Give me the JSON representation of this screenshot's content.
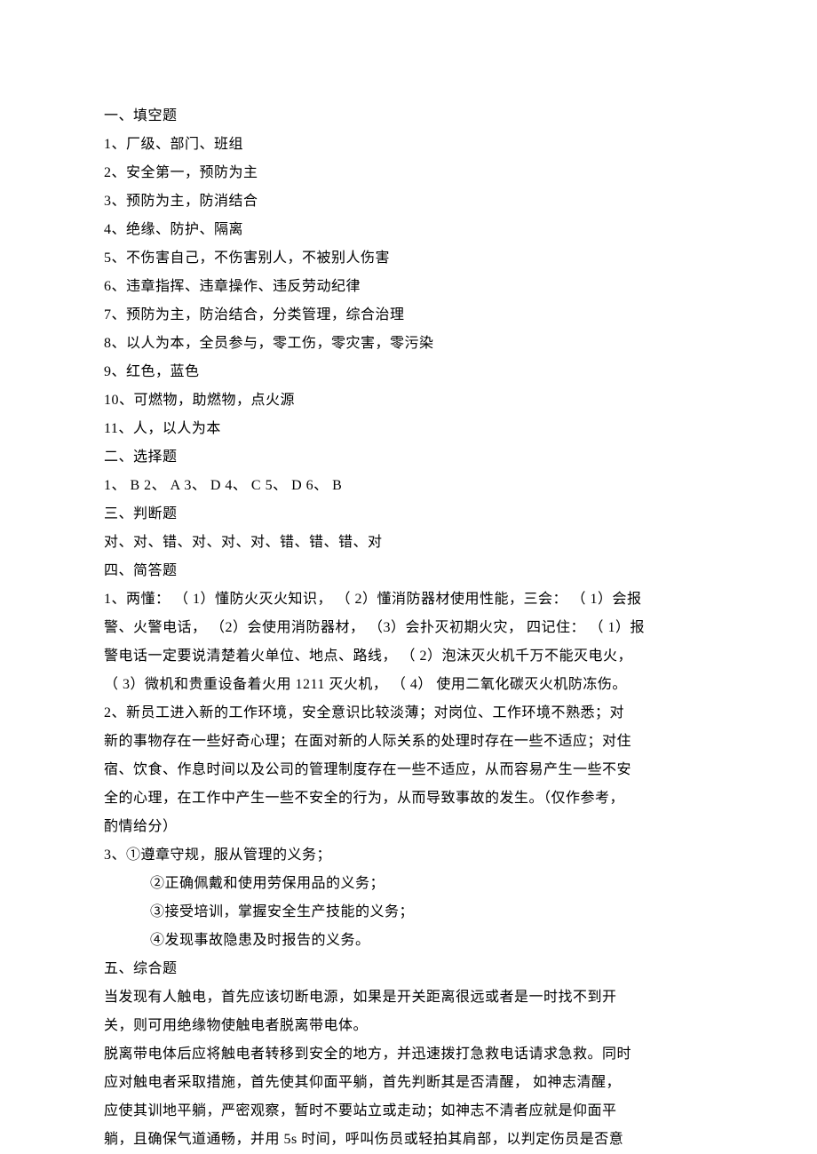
{
  "sections": {
    "s1_title": "一、填空题",
    "s1_items": [
      "1、厂级、部门、班组",
      "2、安全第一，预防为主",
      "3、预防为主，防消结合",
      "4、绝缘、防护、隔离",
      "5、不伤害自己，不伤害别人，不被别人伤害",
      "6、违章指挥、违章操作、违反劳动纪律",
      "7、预防为主，防治结合，分类管理，综合治理",
      "8、以人为本，全员参与，零工伤，零灾害，零污染",
      "9、红色，蓝色",
      "10、可燃物，助燃物，点火源",
      "11、人，以人为本"
    ],
    "s2_title": "二、选择题",
    "s2_content": "1、 B 2、 A 3、 D 4、 C 5、 D 6、 B",
    "s3_title": "三、判断题",
    "s3_content": "对、对、错、对、对、对、错、错、错、对",
    "s4_title": "四、简答题",
    "s4_q1_l1": "1、两懂： （ 1）懂防火灭火知识， （ 2）懂消防器材使用性能，三会： （ 1）会报",
    "s4_q1_l2": "警、火警电话， （2）会使用消防器材， （3）会扑灭初期火灾， 四记住： （ 1）报",
    "s4_q1_l3": "警电话一定要说清楚着火单位、地点、路线， （ 2）泡沫灭火机千万不能灭电火，",
    "s4_q1_l4": "（ 3）微机和贵重设备着火用 1211 灭火机， （ 4） 使用二氧化碳灭火机防冻伤。",
    "s4_q2_l1": "2、新员工进入新的工作环境，安全意识比较淡薄；对岗位、工作环境不熟悉；对",
    "s4_q2_l2": "新的事物存在一些好奇心理；在面对新的人际关系的处理时存在一些不适应；对住",
    "s4_q2_l3": "宿、饮食、作息时间以及公司的管理制度存在一些不适应，从而容易产生一些不安",
    "s4_q2_l4": "全的心理，在工作中产生一些不安全的行为，从而导致事故的发生。（仅作参考，",
    "s4_q2_l5": "酌情给分）",
    "s4_q3_l1": "3、①遵章守规，服从管理的义务；",
    "s4_q3_l2": "②正确佩戴和使用劳保用品的义务；",
    "s4_q3_l3": "③接受培训，掌握安全生产技能的义务；",
    "s4_q3_l4": "④发现事故隐患及时报告的义务。",
    "s5_title": "五、综合题",
    "s5_l1": "当发现有人触电，首先应该切断电源，如果是开关距离很远或者是一时找不到开",
    "s5_l2": "关，则可用绝缘物使触电者脱离带电体。",
    "s5_l3": "脱离带电体后应将触电者转移到安全的地方，并迅速拨打急救电话请求急救。同时",
    "s5_l4": "应对触电者采取措施，首先使其仰面平躺，首先判断其是否清醒， 如神志清醒，",
    "s5_l5": "应使其训地平躺，严密观察，暂时不要站立或走动；如神志不清者应就是仰面平",
    "s5_l6": "躺，且确保气道通畅，并用 5s 时间，呼叫伤员或轻拍其肩部，以判定伤员是否意"
  }
}
